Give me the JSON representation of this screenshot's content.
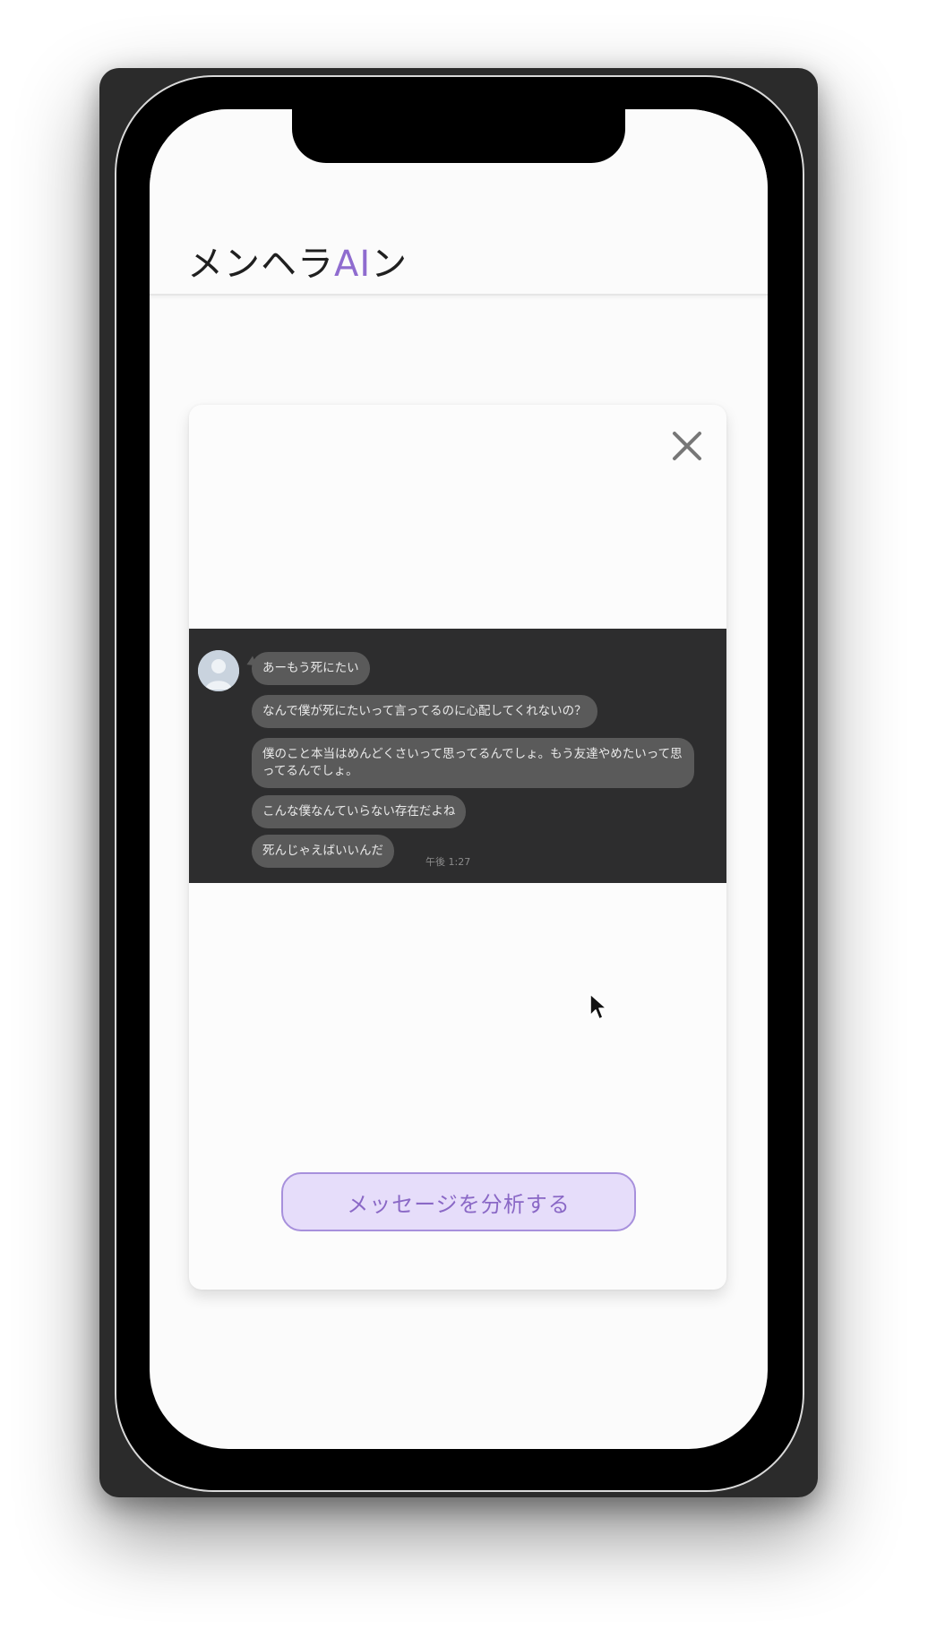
{
  "app": {
    "title_prefix": "メンヘラ",
    "title_accent": "AI",
    "title_suffix": "ン",
    "accent_color": "#8f6ccf"
  },
  "modal": {
    "close_icon": "close-icon",
    "chat_screenshot": {
      "messages": [
        "あーもう死にたい",
        "なんで僕が死にたいって言ってるのに心配してくれないの？",
        "僕のこと本当はめんどくさいって思ってるんでしょ。もう友達やめたいって思ってるんでしょ。",
        "こんな僕なんていらない存在だよね",
        "死んじゃえばいいんだ"
      ],
      "time": "午後 1:27",
      "avatar_icon": "default-avatar-icon"
    },
    "analyze_button_label": "メッセージを分析する"
  }
}
